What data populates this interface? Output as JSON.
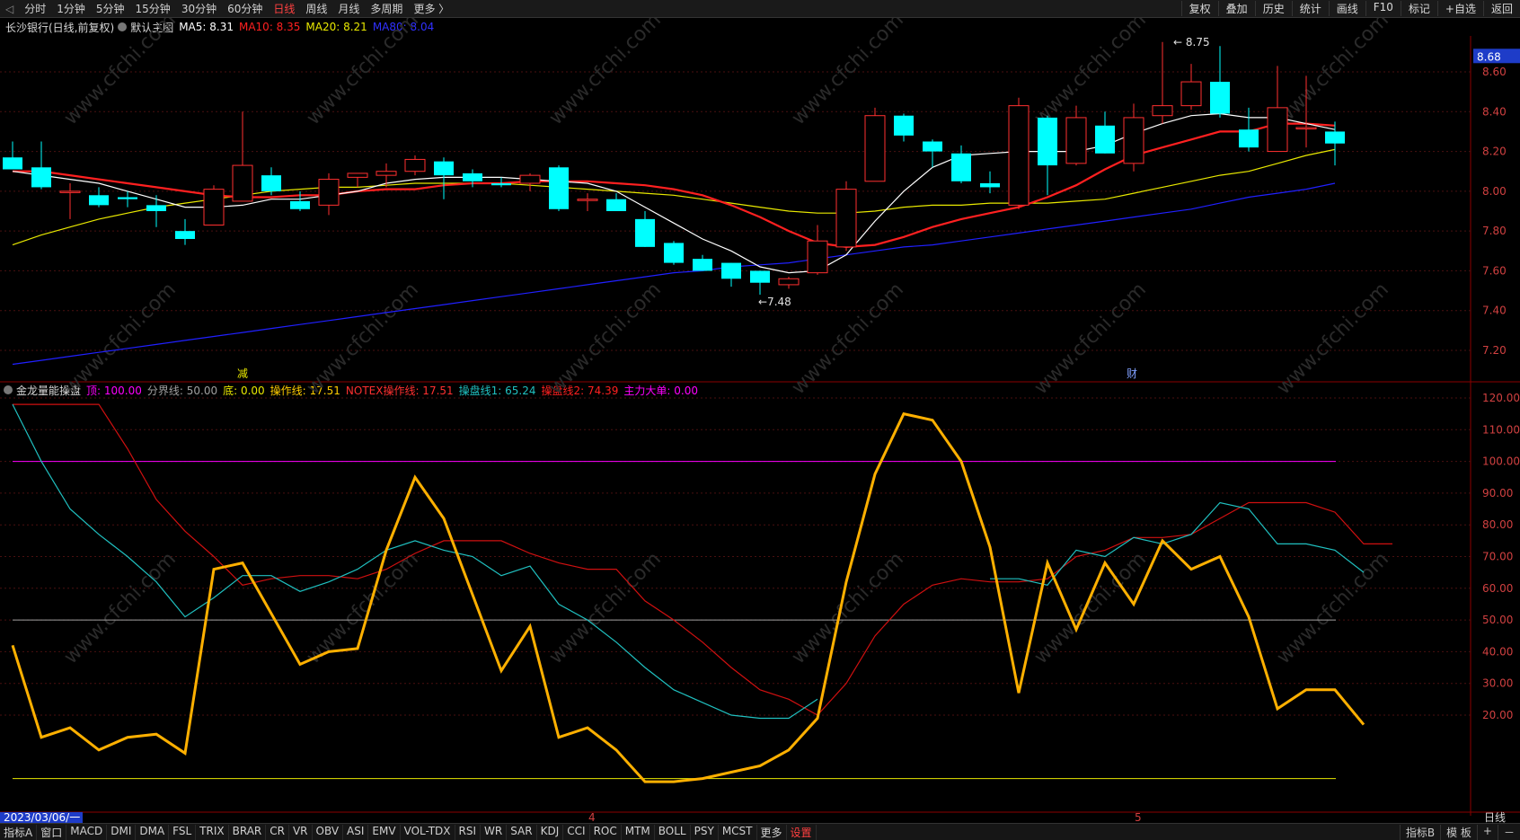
{
  "top_tabs": [
    "分时",
    "1分钟",
    "5分钟",
    "15分钟",
    "30分钟",
    "60分钟",
    "日线",
    "周线",
    "月线",
    "多周期",
    "更多 〉"
  ],
  "top_active": "日线",
  "top_right": [
    "复权",
    "叠加",
    "历史",
    "统计",
    "画线",
    "F10",
    "标记",
    "+自选",
    "返回"
  ],
  "main": {
    "stock": "长沙银行(日线,前复权)",
    "template": "默认主图",
    "ma5": "MA5: 8.31",
    "ma10": "MA10: 8.35",
    "ma20": "MA20: 8.21",
    "ma80": "MA80: 8.04",
    "current_price": "8.68",
    "high_mark": "8.75",
    "low_mark": "7.48",
    "marker_jian": "减",
    "marker_cai": "财",
    "y_ticks": [
      "8.60",
      "8.40",
      "8.20",
      "8.00",
      "7.80",
      "7.60",
      "7.40",
      "7.20"
    ]
  },
  "sub": {
    "name": "金龙量能操盘",
    "ding": "顶: 100.00",
    "fenjie": "分界线: 50.00",
    "di": "底: 0.00",
    "caozuo": "操作线: 17.51",
    "notex": "NOTEX操作线: 17.51",
    "caopan1": "操盘线1: 65.24",
    "caopan2": "操盘线2: 74.39",
    "zhuli": "主力大单: 0.00",
    "y_ticks": [
      "120.00",
      "110.00",
      "100.00",
      "90.00",
      "80.00",
      "70.00",
      "60.00",
      "50.00",
      "40.00",
      "30.00",
      "20.00"
    ]
  },
  "x_labels": {
    "start": "2023/03/06/一",
    "m4": "4",
    "m5": "5",
    "period": "日线"
  },
  "watermark": "www.cfchi.com",
  "bottom_indicators": [
    "指标A",
    "窗口",
    "MACD",
    "DMI",
    "DMA",
    "FSL",
    "TRIX",
    "BRAR",
    "CR",
    "VR",
    "OBV",
    "ASI",
    "EMV",
    "VOL-TDX",
    "RSI",
    "WR",
    "SAR",
    "KDJ",
    "CCI",
    "ROC",
    "MTM",
    "BOLL",
    "PSY",
    "MCST",
    "更多",
    "设置"
  ],
  "bottom_right": [
    "指标B",
    "模 板",
    "+",
    "－"
  ],
  "colors": {
    "up": "#ff3030",
    "down": "#00ffff",
    "ma5": "#ffffff",
    "ma10": "#ff2020",
    "ma20": "#e8e800",
    "ma80": "#2020ff",
    "orange": "#ffa500",
    "cyan": "#20c0c0",
    "magenta": "#ff00ff"
  },
  "chart_data": {
    "type": "candlestick",
    "candles": [
      {
        "o": 8.17,
        "h": 8.25,
        "l": 8.11,
        "c": 8.11
      },
      {
        "o": 8.12,
        "h": 8.25,
        "l": 8.01,
        "c": 8.02
      },
      {
        "o": 8.0,
        "h": 8.04,
        "l": 7.86,
        "c": 8.0
      },
      {
        "o": 7.98,
        "h": 8.02,
        "l": 7.92,
        "c": 7.93
      },
      {
        "o": 7.97,
        "h": 8.0,
        "l": 7.92,
        "c": 7.96
      },
      {
        "o": 7.93,
        "h": 7.98,
        "l": 7.82,
        "c": 7.9
      },
      {
        "o": 7.8,
        "h": 7.86,
        "l": 7.73,
        "c": 7.76
      },
      {
        "o": 7.83,
        "h": 8.03,
        "l": 7.83,
        "c": 8.01
      },
      {
        "o": 7.95,
        "h": 8.4,
        "l": 7.95,
        "c": 8.13
      },
      {
        "o": 8.08,
        "h": 8.12,
        "l": 7.98,
        "c": 8.0
      },
      {
        "o": 7.95,
        "h": 8.0,
        "l": 7.9,
        "c": 7.91
      },
      {
        "o": 7.93,
        "h": 8.09,
        "l": 7.88,
        "c": 8.06
      },
      {
        "o": 8.07,
        "h": 8.09,
        "l": 8.02,
        "c": 8.09
      },
      {
        "o": 8.08,
        "h": 8.14,
        "l": 8.02,
        "c": 8.1
      },
      {
        "o": 8.1,
        "h": 8.18,
        "l": 8.08,
        "c": 8.16
      },
      {
        "o": 8.15,
        "h": 8.17,
        "l": 7.96,
        "c": 8.08
      },
      {
        "o": 8.09,
        "h": 8.11,
        "l": 8.02,
        "c": 8.05
      },
      {
        "o": 8.04,
        "h": 8.07,
        "l": 8.02,
        "c": 8.03
      },
      {
        "o": 8.04,
        "h": 8.09,
        "l": 8.0,
        "c": 8.08
      },
      {
        "o": 8.12,
        "h": 8.13,
        "l": 7.9,
        "c": 7.91
      },
      {
        "o": 7.96,
        "h": 7.99,
        "l": 7.9,
        "c": 7.96
      },
      {
        "o": 7.96,
        "h": 7.99,
        "l": 7.9,
        "c": 7.9
      },
      {
        "o": 7.86,
        "h": 7.9,
        "l": 7.72,
        "c": 7.72
      },
      {
        "o": 7.74,
        "h": 7.75,
        "l": 7.63,
        "c": 7.64
      },
      {
        "o": 7.66,
        "h": 7.68,
        "l": 7.6,
        "c": 7.6
      },
      {
        "o": 7.64,
        "h": 7.64,
        "l": 7.52,
        "c": 7.56
      },
      {
        "o": 7.6,
        "h": 7.6,
        "l": 7.48,
        "c": 7.54
      },
      {
        "o": 7.53,
        "h": 7.57,
        "l": 7.51,
        "c": 7.56
      },
      {
        "o": 7.59,
        "h": 7.83,
        "l": 7.58,
        "c": 7.75
      },
      {
        "o": 7.72,
        "h": 8.05,
        "l": 7.7,
        "c": 8.01
      },
      {
        "o": 8.05,
        "h": 8.42,
        "l": 8.05,
        "c": 8.38
      },
      {
        "o": 8.38,
        "h": 8.39,
        "l": 8.25,
        "c": 8.28
      },
      {
        "o": 8.25,
        "h": 8.26,
        "l": 8.12,
        "c": 8.2
      },
      {
        "o": 8.19,
        "h": 8.23,
        "l": 8.04,
        "c": 8.05
      },
      {
        "o": 8.04,
        "h": 8.1,
        "l": 7.99,
        "c": 8.02
      },
      {
        "o": 7.93,
        "h": 8.47,
        "l": 7.91,
        "c": 8.43
      },
      {
        "o": 8.37,
        "h": 8.38,
        "l": 7.98,
        "c": 8.13
      },
      {
        "o": 8.14,
        "h": 8.43,
        "l": 8.13,
        "c": 8.37
      },
      {
        "o": 8.33,
        "h": 8.4,
        "l": 8.19,
        "c": 8.19
      },
      {
        "o": 8.14,
        "h": 8.44,
        "l": 8.1,
        "c": 8.37
      },
      {
        "o": 8.38,
        "h": 8.75,
        "l": 8.34,
        "c": 8.43
      },
      {
        "o": 8.43,
        "h": 8.64,
        "l": 8.41,
        "c": 8.55
      },
      {
        "o": 8.55,
        "h": 8.73,
        "l": 8.37,
        "c": 8.39
      },
      {
        "o": 8.31,
        "h": 8.42,
        "l": 8.2,
        "c": 8.22
      },
      {
        "o": 8.2,
        "h": 8.63,
        "l": 8.2,
        "c": 8.42
      },
      {
        "o": 8.32,
        "h": 8.58,
        "l": 8.22,
        "c": 8.32
      },
      {
        "o": 8.3,
        "h": 8.35,
        "l": 8.13,
        "c": 8.24
      }
    ],
    "ma5": [
      8.1,
      8.08,
      8.06,
      8.04,
      8.0,
      7.96,
      7.92,
      7.92,
      7.93,
      7.96,
      7.96,
      7.98,
      8.0,
      8.04,
      8.06,
      8.07,
      8.07,
      8.07,
      8.06,
      8.05,
      8.04,
      8.0,
      7.92,
      7.84,
      7.76,
      7.7,
      7.62,
      7.59,
      7.6,
      7.68,
      7.85,
      8.0,
      8.12,
      8.18,
      8.19,
      8.2,
      8.2,
      8.2,
      8.23,
      8.29,
      8.34,
      8.38,
      8.39,
      8.37,
      8.37,
      8.34,
      8.31
    ],
    "ma10": [
      8.1,
      8.1,
      8.08,
      8.06,
      8.04,
      8.02,
      8.0,
      7.98,
      7.97,
      7.97,
      7.98,
      7.98,
      8.0,
      8.01,
      8.01,
      8.03,
      8.04,
      8.04,
      8.05,
      8.05,
      8.05,
      8.04,
      8.03,
      8.01,
      7.98,
      7.93,
      7.87,
      7.8,
      7.74,
      7.72,
      7.73,
      7.77,
      7.82,
      7.86,
      7.89,
      7.92,
      7.97,
      8.03,
      8.11,
      8.18,
      8.22,
      8.26,
      8.3,
      8.3,
      8.34,
      8.34,
      8.33
    ],
    "ma20": [
      7.73,
      7.78,
      7.82,
      7.86,
      7.89,
      7.92,
      7.94,
      7.96,
      7.98,
      8.0,
      8.01,
      8.02,
      8.02,
      8.03,
      8.04,
      8.04,
      8.04,
      8.04,
      8.03,
      8.02,
      8.01,
      8.0,
      7.99,
      7.98,
      7.96,
      7.94,
      7.92,
      7.9,
      7.89,
      7.89,
      7.9,
      7.92,
      7.93,
      7.93,
      7.94,
      7.94,
      7.94,
      7.95,
      7.96,
      7.99,
      8.02,
      8.05,
      8.08,
      8.1,
      8.14,
      8.18,
      8.21
    ],
    "ma80": [
      7.13,
      7.15,
      7.17,
      7.19,
      7.21,
      7.23,
      7.25,
      7.27,
      7.29,
      7.31,
      7.33,
      7.35,
      7.37,
      7.39,
      7.41,
      7.43,
      7.45,
      7.47,
      7.49,
      7.51,
      7.53,
      7.55,
      7.57,
      7.59,
      7.6,
      7.62,
      7.63,
      7.64,
      7.66,
      7.68,
      7.7,
      7.72,
      7.73,
      7.75,
      7.77,
      7.79,
      7.81,
      7.83,
      7.85,
      7.87,
      7.89,
      7.91,
      7.94,
      7.97,
      7.99,
      8.01,
      8.04
    ],
    "orange": [
      42,
      13,
      16,
      9,
      13,
      14,
      8,
      66,
      68,
      52,
      36,
      40,
      41,
      72,
      95,
      82,
      58,
      34,
      48,
      13,
      16,
      9,
      -1,
      -1,
      0,
      2,
      4,
      9,
      19,
      62,
      96,
      115,
      113,
      100,
      73,
      27,
      68,
      47,
      68,
      55,
      75,
      66,
      70,
      51,
      22,
      28,
      28,
      17
    ],
    "cyan": [
      118,
      100,
      85,
      77,
      70,
      62,
      51,
      57,
      64,
      64,
      59,
      62,
      66,
      72,
      75,
      72,
      70,
      64,
      67,
      55,
      50,
      43,
      35,
      28,
      24,
      20,
      19,
      19,
      25,
      null,
      null,
      null,
      null,
      null,
      63,
      63,
      61,
      72,
      70,
      76,
      74,
      77,
      87,
      85,
      74,
      74,
      72,
      65
    ],
    "red": [
      118,
      118,
      118,
      118,
      104,
      88,
      78,
      70,
      61,
      63,
      64,
      64,
      63,
      66,
      71,
      75,
      75,
      75,
      71,
      68,
      66,
      66,
      56,
      50,
      43,
      35,
      28,
      25,
      20,
      30,
      45,
      55,
      61,
      63,
      62,
      62,
      63,
      70,
      72,
      76,
      76,
      77,
      82,
      87,
      87,
      87,
      84,
      74,
      74
    ]
  }
}
